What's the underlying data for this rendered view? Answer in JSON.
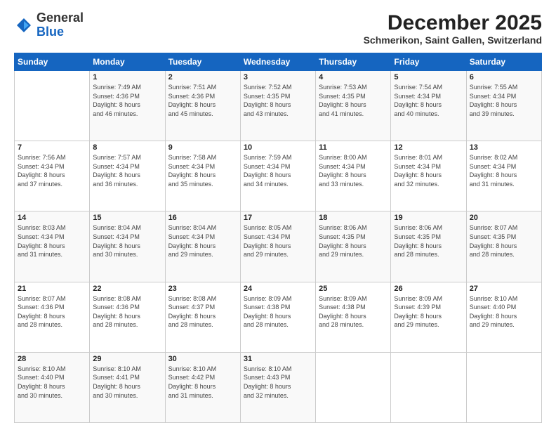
{
  "logo": {
    "general": "General",
    "blue": "Blue"
  },
  "header": {
    "title": "December 2025",
    "subtitle": "Schmerikon, Saint Gallen, Switzerland"
  },
  "columns": [
    "Sunday",
    "Monday",
    "Tuesday",
    "Wednesday",
    "Thursday",
    "Friday",
    "Saturday"
  ],
  "weeks": [
    [
      {
        "day": "",
        "sunrise": "",
        "sunset": "",
        "daylight": ""
      },
      {
        "day": "1",
        "sunrise": "Sunrise: 7:49 AM",
        "sunset": "Sunset: 4:36 PM",
        "daylight": "Daylight: 8 hours and 46 minutes."
      },
      {
        "day": "2",
        "sunrise": "Sunrise: 7:51 AM",
        "sunset": "Sunset: 4:36 PM",
        "daylight": "Daylight: 8 hours and 45 minutes."
      },
      {
        "day": "3",
        "sunrise": "Sunrise: 7:52 AM",
        "sunset": "Sunset: 4:35 PM",
        "daylight": "Daylight: 8 hours and 43 minutes."
      },
      {
        "day": "4",
        "sunrise": "Sunrise: 7:53 AM",
        "sunset": "Sunset: 4:35 PM",
        "daylight": "Daylight: 8 hours and 41 minutes."
      },
      {
        "day": "5",
        "sunrise": "Sunrise: 7:54 AM",
        "sunset": "Sunset: 4:34 PM",
        "daylight": "Daylight: 8 hours and 40 minutes."
      },
      {
        "day": "6",
        "sunrise": "Sunrise: 7:55 AM",
        "sunset": "Sunset: 4:34 PM",
        "daylight": "Daylight: 8 hours and 39 minutes."
      }
    ],
    [
      {
        "day": "7",
        "sunrise": "Sunrise: 7:56 AM",
        "sunset": "Sunset: 4:34 PM",
        "daylight": "Daylight: 8 hours and 37 minutes."
      },
      {
        "day": "8",
        "sunrise": "Sunrise: 7:57 AM",
        "sunset": "Sunset: 4:34 PM",
        "daylight": "Daylight: 8 hours and 36 minutes."
      },
      {
        "day": "9",
        "sunrise": "Sunrise: 7:58 AM",
        "sunset": "Sunset: 4:34 PM",
        "daylight": "Daylight: 8 hours and 35 minutes."
      },
      {
        "day": "10",
        "sunrise": "Sunrise: 7:59 AM",
        "sunset": "Sunset: 4:34 PM",
        "daylight": "Daylight: 8 hours and 34 minutes."
      },
      {
        "day": "11",
        "sunrise": "Sunrise: 8:00 AM",
        "sunset": "Sunset: 4:34 PM",
        "daylight": "Daylight: 8 hours and 33 minutes."
      },
      {
        "day": "12",
        "sunrise": "Sunrise: 8:01 AM",
        "sunset": "Sunset: 4:34 PM",
        "daylight": "Daylight: 8 hours and 32 minutes."
      },
      {
        "day": "13",
        "sunrise": "Sunrise: 8:02 AM",
        "sunset": "Sunset: 4:34 PM",
        "daylight": "Daylight: 8 hours and 31 minutes."
      }
    ],
    [
      {
        "day": "14",
        "sunrise": "Sunrise: 8:03 AM",
        "sunset": "Sunset: 4:34 PM",
        "daylight": "Daylight: 8 hours and 31 minutes."
      },
      {
        "day": "15",
        "sunrise": "Sunrise: 8:04 AM",
        "sunset": "Sunset: 4:34 PM",
        "daylight": "Daylight: 8 hours and 30 minutes."
      },
      {
        "day": "16",
        "sunrise": "Sunrise: 8:04 AM",
        "sunset": "Sunset: 4:34 PM",
        "daylight": "Daylight: 8 hours and 29 minutes."
      },
      {
        "day": "17",
        "sunrise": "Sunrise: 8:05 AM",
        "sunset": "Sunset: 4:34 PM",
        "daylight": "Daylight: 8 hours and 29 minutes."
      },
      {
        "day": "18",
        "sunrise": "Sunrise: 8:06 AM",
        "sunset": "Sunset: 4:35 PM",
        "daylight": "Daylight: 8 hours and 29 minutes."
      },
      {
        "day": "19",
        "sunrise": "Sunrise: 8:06 AM",
        "sunset": "Sunset: 4:35 PM",
        "daylight": "Daylight: 8 hours and 28 minutes."
      },
      {
        "day": "20",
        "sunrise": "Sunrise: 8:07 AM",
        "sunset": "Sunset: 4:35 PM",
        "daylight": "Daylight: 8 hours and 28 minutes."
      }
    ],
    [
      {
        "day": "21",
        "sunrise": "Sunrise: 8:07 AM",
        "sunset": "Sunset: 4:36 PM",
        "daylight": "Daylight: 8 hours and 28 minutes."
      },
      {
        "day": "22",
        "sunrise": "Sunrise: 8:08 AM",
        "sunset": "Sunset: 4:36 PM",
        "daylight": "Daylight: 8 hours and 28 minutes."
      },
      {
        "day": "23",
        "sunrise": "Sunrise: 8:08 AM",
        "sunset": "Sunset: 4:37 PM",
        "daylight": "Daylight: 8 hours and 28 minutes."
      },
      {
        "day": "24",
        "sunrise": "Sunrise: 8:09 AM",
        "sunset": "Sunset: 4:38 PM",
        "daylight": "Daylight: 8 hours and 28 minutes."
      },
      {
        "day": "25",
        "sunrise": "Sunrise: 8:09 AM",
        "sunset": "Sunset: 4:38 PM",
        "daylight": "Daylight: 8 hours and 28 minutes."
      },
      {
        "day": "26",
        "sunrise": "Sunrise: 8:09 AM",
        "sunset": "Sunset: 4:39 PM",
        "daylight": "Daylight: 8 hours and 29 minutes."
      },
      {
        "day": "27",
        "sunrise": "Sunrise: 8:10 AM",
        "sunset": "Sunset: 4:40 PM",
        "daylight": "Daylight: 8 hours and 29 minutes."
      }
    ],
    [
      {
        "day": "28",
        "sunrise": "Sunrise: 8:10 AM",
        "sunset": "Sunset: 4:40 PM",
        "daylight": "Daylight: 8 hours and 30 minutes."
      },
      {
        "day": "29",
        "sunrise": "Sunrise: 8:10 AM",
        "sunset": "Sunset: 4:41 PM",
        "daylight": "Daylight: 8 hours and 30 minutes."
      },
      {
        "day": "30",
        "sunrise": "Sunrise: 8:10 AM",
        "sunset": "Sunset: 4:42 PM",
        "daylight": "Daylight: 8 hours and 31 minutes."
      },
      {
        "day": "31",
        "sunrise": "Sunrise: 8:10 AM",
        "sunset": "Sunset: 4:43 PM",
        "daylight": "Daylight: 8 hours and 32 minutes."
      },
      {
        "day": "",
        "sunrise": "",
        "sunset": "",
        "daylight": ""
      },
      {
        "day": "",
        "sunrise": "",
        "sunset": "",
        "daylight": ""
      },
      {
        "day": "",
        "sunrise": "",
        "sunset": "",
        "daylight": ""
      }
    ]
  ]
}
